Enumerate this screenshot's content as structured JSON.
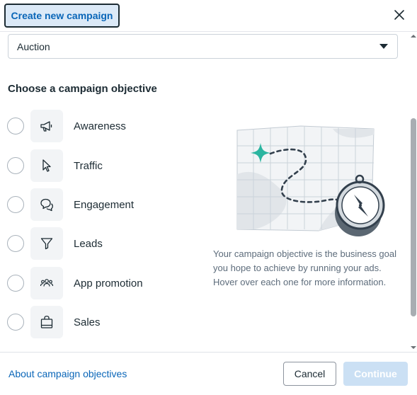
{
  "header": {
    "title_button": "Create new campaign",
    "close_icon": "close-icon"
  },
  "buying_type": {
    "selected": "Auction"
  },
  "section": {
    "title": "Choose a campaign objective"
  },
  "objectives": [
    {
      "label": "Awareness",
      "icon": "megaphone-icon"
    },
    {
      "label": "Traffic",
      "icon": "cursor-icon"
    },
    {
      "label": "Engagement",
      "icon": "chat-bubbles-icon"
    },
    {
      "label": "Leads",
      "icon": "funnel-icon"
    },
    {
      "label": "App promotion",
      "icon": "people-icon"
    },
    {
      "label": "Sales",
      "icon": "shopping-bag-icon"
    }
  ],
  "info": {
    "description": "Your campaign objective is the business goal you hope to achieve by running your ads. Hover over each one for more information."
  },
  "footer": {
    "about_link": "About campaign objectives",
    "cancel_label": "Cancel",
    "continue_label": "Continue"
  },
  "colors": {
    "link": "#0a66b8",
    "accent_teal": "#2bb5a0",
    "continue_disabled": "#cbe0f4"
  }
}
